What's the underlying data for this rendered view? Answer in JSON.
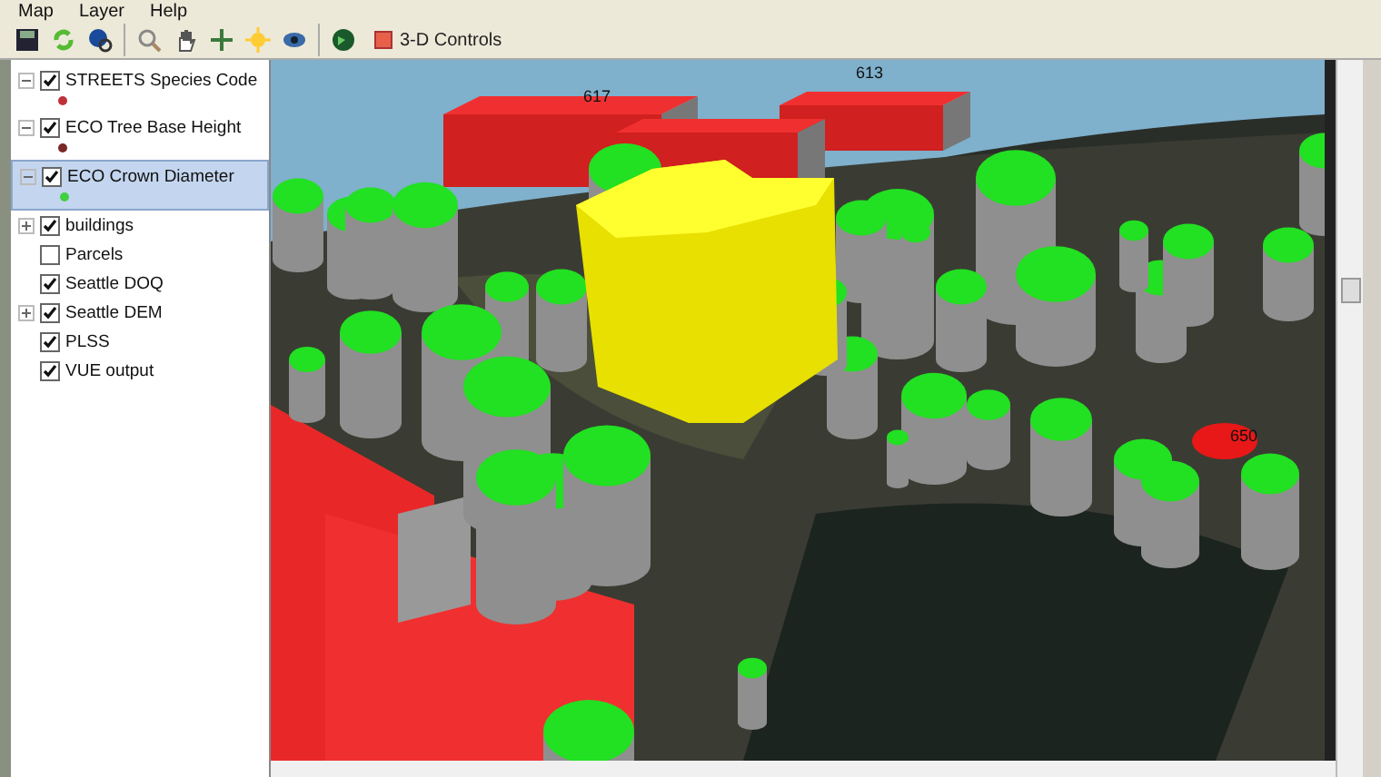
{
  "menu": [
    "Map",
    "Layer",
    "Help"
  ],
  "toolbar": {
    "button": "3-D Controls"
  },
  "layers": [
    {
      "label": "STREETS Species Code",
      "checked": true,
      "expanded": true,
      "selected": false,
      "color": "#c0303a"
    },
    {
      "label": "ECO Tree Base Height",
      "checked": true,
      "expanded": true,
      "selected": false,
      "color": "#7a2828"
    },
    {
      "label": "ECO Crown Diameter",
      "checked": true,
      "expanded": true,
      "selected": true,
      "color": "#40d040"
    },
    {
      "label": "buildings",
      "checked": true,
      "expanded": false,
      "selected": false
    },
    {
      "label": "Parcels",
      "checked": false,
      "selected": false
    },
    {
      "label": "Seattle DOQ",
      "checked": true,
      "selected": false
    },
    {
      "label": "Seattle DEM",
      "checked": true,
      "expanded": false,
      "selected": false
    },
    {
      "label": "PLSS",
      "checked": true,
      "selected": false
    },
    {
      "label": "VUE output",
      "checked": true,
      "selected": false
    }
  ],
  "scene": {
    "labels": [
      "617",
      "613",
      "650"
    ]
  }
}
